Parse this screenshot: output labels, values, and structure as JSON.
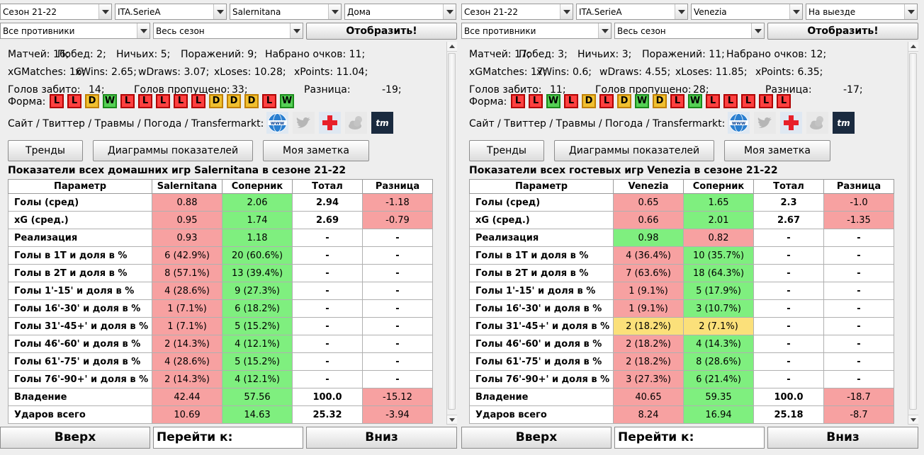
{
  "panels": [
    {
      "team": "Salernitana",
      "combos": {
        "season": "Сезон 21-22",
        "league": "ITA.SerieA",
        "team": "Salernitana",
        "venue": "Дома",
        "opponents": "Все противники",
        "period": "Весь сезон"
      },
      "show_button": "Отобразить!",
      "stats": {
        "line1": [
          "Матчей: 16;",
          "Побед: 2;",
          "Ничьих: 5;",
          "Поражений: 9;",
          "Набрано очков: 11;"
        ],
        "line2": [
          "xGMatches: 16;",
          "xWins: 2.65;",
          "wDraws: 3.07;",
          "xLoses: 10.28;",
          "xPoints: 11.04;"
        ],
        "line3": [
          "Голов забито:",
          "14;",
          "Голов пропущено:",
          "33;",
          "Разница:",
          "-19;"
        ]
      },
      "forma_label": "Форма:",
      "forma": [
        "L",
        "L",
        "D",
        "W",
        "L",
        "L",
        "L",
        "L",
        "L",
        "D",
        "D",
        "D",
        "L",
        "W"
      ],
      "links_label": "Сайт / Твиттер / Травмы / Погода / Transfermarkt:",
      "buttons": {
        "trends": "Тренды",
        "charts": "Диаграммы показателей",
        "note": "Моя заметка"
      },
      "table_title": "Показатели всех домашних игр Salernitana в сезоне 21-22",
      "headers": [
        "Параметр",
        "Salernitana",
        "Соперник",
        "Тотал",
        "Разница"
      ],
      "rows": [
        [
          "Голы (сред)",
          "0.88",
          "2.06",
          "2.94",
          "-1.18"
        ],
        [
          "xG (сред.)",
          "0.95",
          "1.74",
          "2.69",
          "-0.79"
        ],
        [
          "Реализация",
          "0.93",
          "1.18",
          "-",
          "-"
        ],
        [
          "Голы в 1Т и доля в %",
          "6 (42.9%)",
          "20 (60.6%)",
          "-",
          "-"
        ],
        [
          "Голы в 2Т и доля в %",
          "8 (57.1%)",
          "13 (39.4%)",
          "-",
          "-"
        ],
        [
          "Голы 1'-15' и доля в %",
          "4 (28.6%)",
          "9 (27.3%)",
          "-",
          "-"
        ],
        [
          "Голы 16'-30' и доля в %",
          "1 (7.1%)",
          "6 (18.2%)",
          "-",
          "-"
        ],
        [
          "Голы 31'-45+' и доля в %",
          "1 (7.1%)",
          "5 (15.2%)",
          "-",
          "-"
        ],
        [
          "Голы 46'-60' и доля в %",
          "2 (14.3%)",
          "4 (12.1%)",
          "-",
          "-"
        ],
        [
          "Голы 61'-75' и доля в %",
          "4 (28.6%)",
          "5 (15.2%)",
          "-",
          "-"
        ],
        [
          "Голы 76'-90+' и доля в %",
          "2 (14.3%)",
          "4 (12.1%)",
          "-",
          "-"
        ],
        [
          "Владение",
          "42.44",
          "57.56",
          "100.0",
          "-15.12"
        ],
        [
          "Ударов всего",
          "10.69",
          "14.63",
          "25.32",
          "-3.94"
        ]
      ],
      "row_colors": [
        [
          "r",
          "g",
          "n",
          "r"
        ],
        [
          "r",
          "g",
          "n",
          "r"
        ],
        [
          "r",
          "g",
          "n",
          "n"
        ],
        [
          "r",
          "g",
          "n",
          "n"
        ],
        [
          "r",
          "g",
          "n",
          "n"
        ],
        [
          "r",
          "g",
          "n",
          "n"
        ],
        [
          "r",
          "g",
          "n",
          "n"
        ],
        [
          "r",
          "g",
          "n",
          "n"
        ],
        [
          "r",
          "g",
          "n",
          "n"
        ],
        [
          "r",
          "g",
          "n",
          "n"
        ],
        [
          "r",
          "g",
          "n",
          "n"
        ],
        [
          "r",
          "g",
          "n",
          "r"
        ],
        [
          "r",
          "g",
          "n",
          "r"
        ]
      ],
      "bottom": {
        "up": "Вверх",
        "goto": "Перейти к:",
        "down": "Вниз"
      }
    },
    {
      "team": "Venezia",
      "combos": {
        "season": "Сезон 21-22",
        "league": "ITA.SerieA",
        "team": "Venezia",
        "venue": "На выезде",
        "opponents": "Все противники",
        "period": "Весь сезон"
      },
      "show_button": "Отобразить!",
      "stats": {
        "line1": [
          "Матчей: 17;",
          "Побед: 3;",
          "Ничьих: 3;",
          "Поражений: 11;",
          "Набрано очков: 12;"
        ],
        "line2": [
          "xGMatches: 17;",
          "xWins: 0.6;",
          "wDraws: 4.55;",
          "xLoses: 11.85;",
          "xPoints: 6.35;"
        ],
        "line3": [
          "Голов забито:",
          "11;",
          "Голов пропущено:",
          "28;",
          "Разница:",
          "-17;"
        ]
      },
      "forma_label": "Форма:",
      "forma": [
        "L",
        "L",
        "W",
        "L",
        "D",
        "L",
        "D",
        "W",
        "D",
        "L",
        "W",
        "L",
        "L",
        "L",
        "L",
        "L"
      ],
      "links_label": "Сайт / Твиттер / Травмы / Погода / Transfermarkt:",
      "buttons": {
        "trends": "Тренды",
        "charts": "Диаграммы показателей",
        "note": "Моя заметка"
      },
      "table_title": "Показатели всех гостевых игр Venezia в сезоне 21-22",
      "headers": [
        "Параметр",
        "Venezia",
        "Соперник",
        "Тотал",
        "Разница"
      ],
      "rows": [
        [
          "Голы (сред)",
          "0.65",
          "1.65",
          "2.3",
          "-1.0"
        ],
        [
          "xG (сред.)",
          "0.66",
          "2.01",
          "2.67",
          "-1.35"
        ],
        [
          "Реализация",
          "0.98",
          "0.82",
          "-",
          "-"
        ],
        [
          "Голы в 1Т и доля в %",
          "4 (36.4%)",
          "10 (35.7%)",
          "-",
          "-"
        ],
        [
          "Голы в 2Т и доля в %",
          "7 (63.6%)",
          "18 (64.3%)",
          "-",
          "-"
        ],
        [
          "Голы 1'-15' и доля в %",
          "1 (9.1%)",
          "5 (17.9%)",
          "-",
          "-"
        ],
        [
          "Голы 16'-30' и доля в %",
          "1 (9.1%)",
          "3 (10.7%)",
          "-",
          "-"
        ],
        [
          "Голы 31'-45+' и доля в %",
          "2 (18.2%)",
          "2 (7.1%)",
          "-",
          "-"
        ],
        [
          "Голы 46'-60' и доля в %",
          "2 (18.2%)",
          "4 (14.3%)",
          "-",
          "-"
        ],
        [
          "Голы 61'-75' и доля в %",
          "2 (18.2%)",
          "8 (28.6%)",
          "-",
          "-"
        ],
        [
          "Голы 76'-90+' и доля в %",
          "3 (27.3%)",
          "6 (21.4%)",
          "-",
          "-"
        ],
        [
          "Владение",
          "40.65",
          "59.35",
          "100.0",
          "-18.7"
        ],
        [
          "Ударов всего",
          "8.24",
          "16.94",
          "25.18",
          "-8.7"
        ]
      ],
      "row_colors": [
        [
          "r",
          "g",
          "n",
          "r"
        ],
        [
          "r",
          "g",
          "n",
          "r"
        ],
        [
          "g",
          "r",
          "n",
          "n"
        ],
        [
          "r",
          "g",
          "n",
          "n"
        ],
        [
          "r",
          "g",
          "n",
          "n"
        ],
        [
          "r",
          "g",
          "n",
          "n"
        ],
        [
          "r",
          "g",
          "n",
          "n"
        ],
        [
          "y",
          "y",
          "n",
          "n"
        ],
        [
          "r",
          "g",
          "n",
          "n"
        ],
        [
          "r",
          "g",
          "n",
          "n"
        ],
        [
          "r",
          "g",
          "n",
          "n"
        ],
        [
          "r",
          "g",
          "n",
          "r"
        ],
        [
          "r",
          "g",
          "n",
          "r"
        ]
      ],
      "bottom": {
        "up": "Вверх",
        "goto": "Перейти к:",
        "down": "Вниз"
      }
    }
  ]
}
